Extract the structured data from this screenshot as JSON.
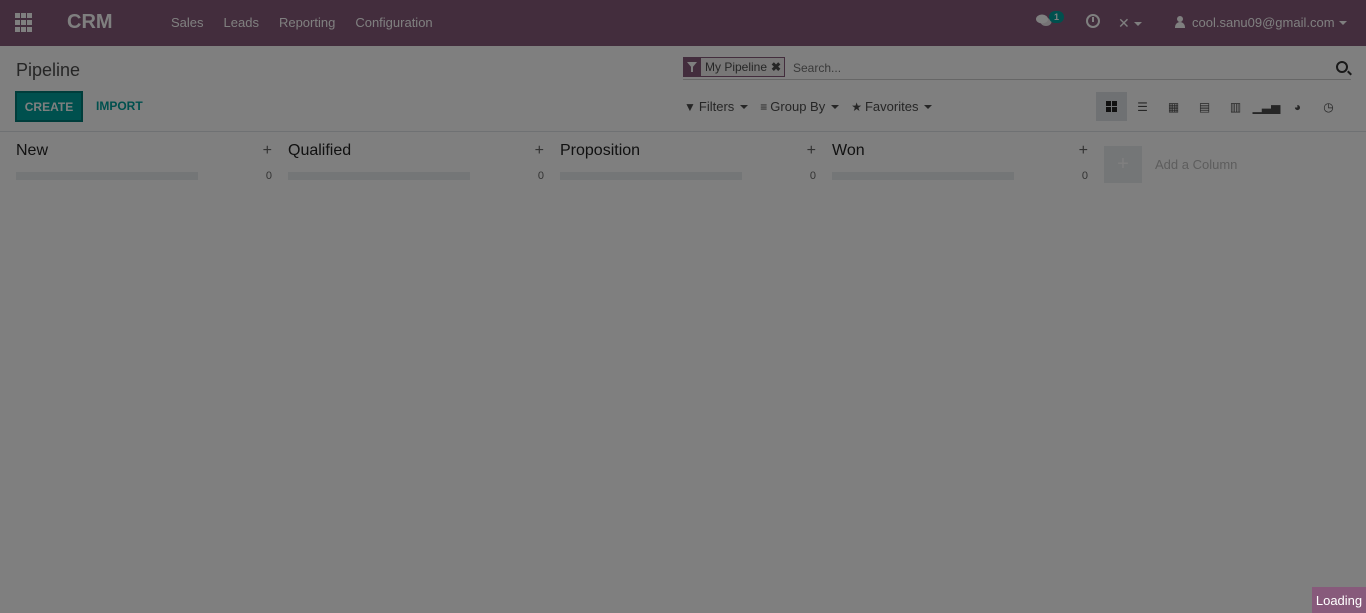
{
  "app": {
    "brand": "CRM"
  },
  "menu": [
    "Sales",
    "Leads",
    "Reporting",
    "Configuration"
  ],
  "systray": {
    "chat_count": "1",
    "user": "cool.sanu09@gmail.com"
  },
  "control_panel": {
    "breadcrumb": "Pipeline",
    "create_label": "CREATE",
    "import_label": "IMPORT",
    "facet_label": "My Pipeline",
    "search_placeholder": "Search...",
    "filters_label": "Filters",
    "groupby_label": "Group By",
    "favorites_label": "Favorites"
  },
  "columns": [
    {
      "title": "New",
      "count": "0"
    },
    {
      "title": "Qualified",
      "count": "0"
    },
    {
      "title": "Proposition",
      "count": "0"
    },
    {
      "title": "Won",
      "count": "0"
    }
  ],
  "add_column_label": "Add a Column",
  "loading_label": "Loading",
  "colors": {
    "brand": "#875a7b",
    "accent": "#00a09d"
  }
}
